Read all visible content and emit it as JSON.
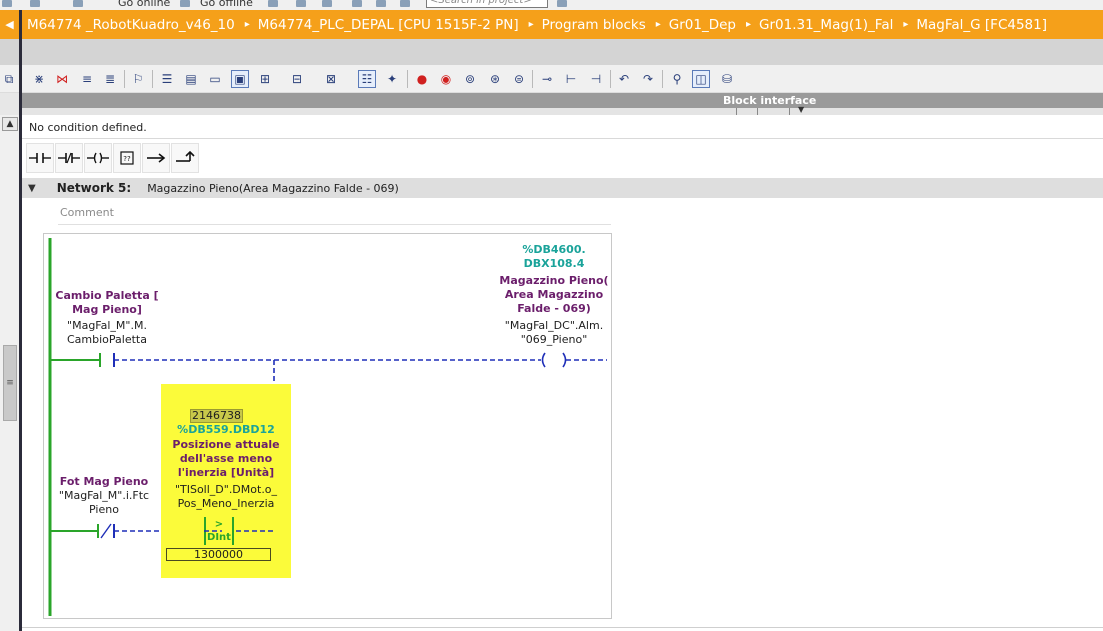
{
  "topbar": {
    "fragments": [
      "Go online",
      "Go offline"
    ],
    "search_placeholder": "<Search in project>"
  },
  "breadcrumb": {
    "items": [
      "M64774 _RobotKuadro_v46_10",
      "M64774_PLC_DEPAL [CPU 1515F-2 PN]",
      "Program blocks",
      "Gr01_Dep",
      "Gr01.31_Mag(1)_Fal",
      "MagFal_G [FC4581]"
    ],
    "separator": "▸"
  },
  "block_interface": {
    "label": "Block interface"
  },
  "condition": {
    "text": "No condition defined."
  },
  "lad_toolbar": {
    "items": [
      "no-contact",
      "nc-contact",
      "coil",
      "empty-box",
      "open-branch",
      "close-branch"
    ]
  },
  "network": {
    "title": "Network 5:",
    "subtitle": "Magazzino  Pieno(Area Magazzino Falde - 069)",
    "comment_placeholder": "Comment"
  },
  "ladder": {
    "contact1": {
      "name_line1": "Cambio Paletta [",
      "name_line2": "Mag Pieno]",
      "tag_line1": "\"MagFal_M\".M.",
      "tag_line2": "CambioPaletta"
    },
    "contact2": {
      "name": "Fot Mag Pieno",
      "tag_line1": "\"MagFal_M\".i.Ftc",
      "tag_line2": "Pieno"
    },
    "coil": {
      "addr_line1": "%DB4600.",
      "addr_line2": "DBX108.4",
      "name_line1": "Magazzino  Pieno(",
      "name_line2": "Area Magazzino",
      "name_line3": "Falde - 069)",
      "tag_line1": "\"MagFal_DC\".Alm.",
      "tag_line2": "\"069_Pieno\""
    },
    "compare": {
      "live_value": "2146738",
      "address": "%DB559.DBD12",
      "name_line1": "Posizione attuale",
      "name_line2": "dell'asse meno",
      "name_line3": "l'inerzia [Unità]",
      "tag_line1": "\"TISoll_D\".DMot.o_",
      "tag_line2": "Pos_Meno_Inerzia",
      "operator": ">",
      "type": "DInt",
      "constant": "1300000"
    }
  },
  "colors": {
    "breadcrumb_bg": "#f5a01a",
    "compare_bg": "#fbfb3a",
    "wire": "#1f2fb8",
    "rail": "#2aa52a",
    "label_purple": "#6b1e6b",
    "address_teal": "#1aa39a"
  }
}
